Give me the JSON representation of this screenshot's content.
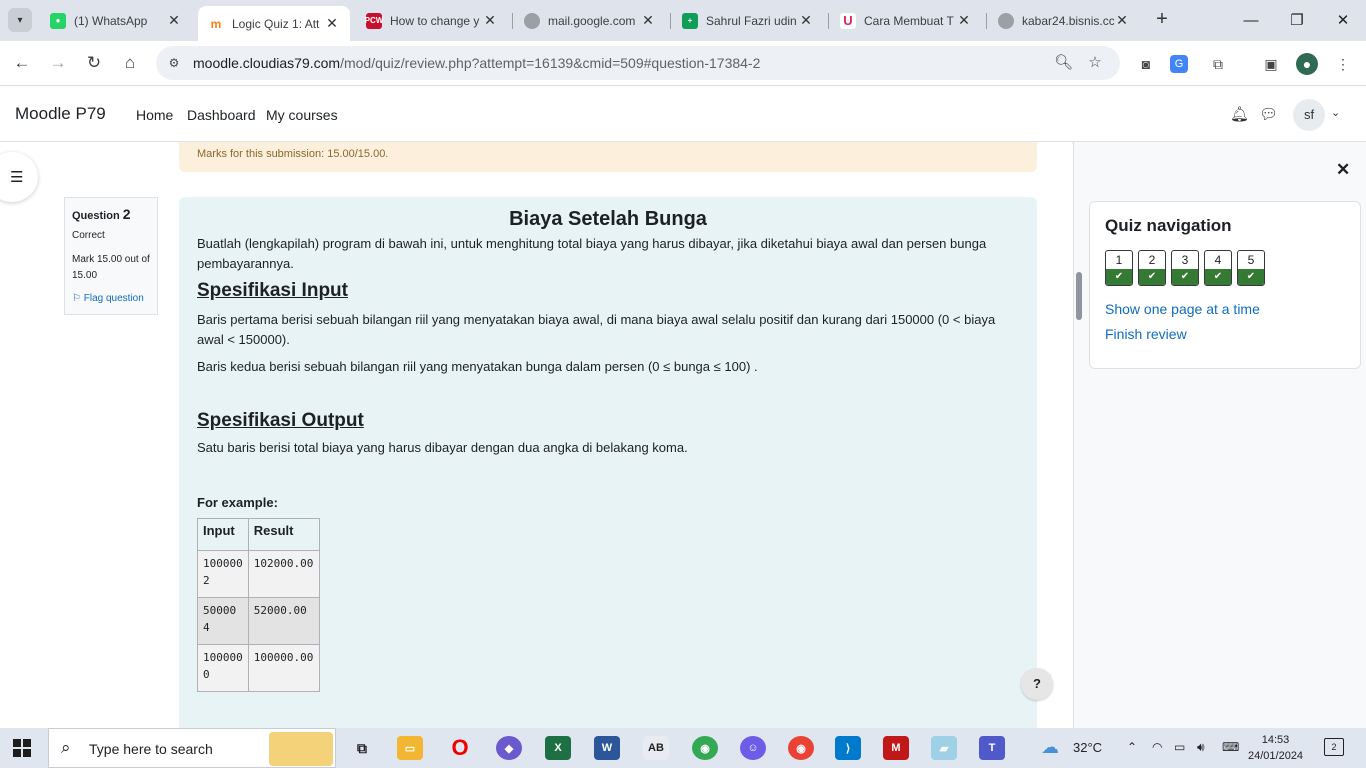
{
  "browser": {
    "tabs": [
      {
        "title": "(1) WhatsApp",
        "icon": "whatsapp-icon",
        "color": "#25d366"
      },
      {
        "title": "Logic Quiz 1: Att",
        "icon": "moodle-icon",
        "color": "#f98012"
      },
      {
        "title": "How to change y",
        "icon": "pcworld-icon",
        "color": "#c8102e"
      },
      {
        "title": "mail.google.com",
        "icon": "globe-icon",
        "color": "#9aa0a6"
      },
      {
        "title": "Sahrul Fazri udin",
        "icon": "sheets-icon",
        "color": "#0f9d58"
      },
      {
        "title": "Cara Membuat T",
        "icon": "magnet-icon",
        "color": "#e0245e"
      },
      {
        "title": "kabar24.bisnis.cc",
        "icon": "globe-icon",
        "color": "#9aa0a6"
      }
    ],
    "url_host": "moodle.cloudias79.com",
    "url_path": "/mod/quiz/review.php?attempt=16139&cmid=509#question-17384-2",
    "profile_badge": "..."
  },
  "moodle": {
    "brand": "Moodle P79",
    "nav": [
      "Home",
      "Dashboard",
      "My courses"
    ],
    "user_initials": "sf"
  },
  "review": {
    "marks_text": "Marks for this submission: 15.00/15.00."
  },
  "question": {
    "label": "Question",
    "number": "2",
    "state": "Correct",
    "grade": "Mark 15.00 out of 15.00",
    "flag": "Flag question",
    "title": "Biaya Setelah Bunga",
    "intro": "Buatlah (lengkapilah) program di bawah ini, untuk menghitung total biaya yang harus dibayar, jika diketahui biaya awal dan persen bunga pembayarannya.",
    "input_heading": "Spesifikasi Input",
    "input_line1": "Baris pertama berisi sebuah bilangan riil yang menyatakan biaya awal, di mana biaya awal selalu positif dan kurang dari 150000 (0 < biaya awal < 150000).",
    "input_line2": "Baris kedua berisi sebuah bilangan riil yang menyatakan bunga dalam persen (0 ≤ bunga ≤ 100) .",
    "output_heading": "Spesifikasi Output",
    "output_line": "Satu baris berisi total biaya yang harus dibayar dengan dua angka di belakang koma.",
    "example_label": "For example:",
    "example_headers": [
      "Input",
      "Result"
    ],
    "examples": [
      {
        "input1": "100000",
        "input2": "2",
        "result": "102000.00"
      },
      {
        "input1": "50000",
        "input2": "4",
        "result": "52000.00"
      },
      {
        "input1": "100000",
        "input2": "0",
        "result": "100000.00"
      }
    ]
  },
  "quiz_nav": {
    "title": "Quiz navigation",
    "buttons": [
      {
        "label": "1",
        "status": "correct"
      },
      {
        "label": "2",
        "status": "correct"
      },
      {
        "label": "3",
        "status": "correct"
      },
      {
        "label": "4",
        "status": "correct"
      },
      {
        "label": "5",
        "status": "correct"
      }
    ],
    "show_one_page": "Show one page at a time",
    "finish_review": "Finish review"
  },
  "help_label": "?",
  "taskbar": {
    "search_placeholder": "Type here to search",
    "weather": "32°C",
    "time": "14:53",
    "date": "24/01/2024",
    "notification_count": "2"
  },
  "colors": {
    "accent": "#0f6cbf",
    "correct": "#357a32",
    "content_bg": "#e7f3f5",
    "feedback_bg": "#fcefdc"
  }
}
